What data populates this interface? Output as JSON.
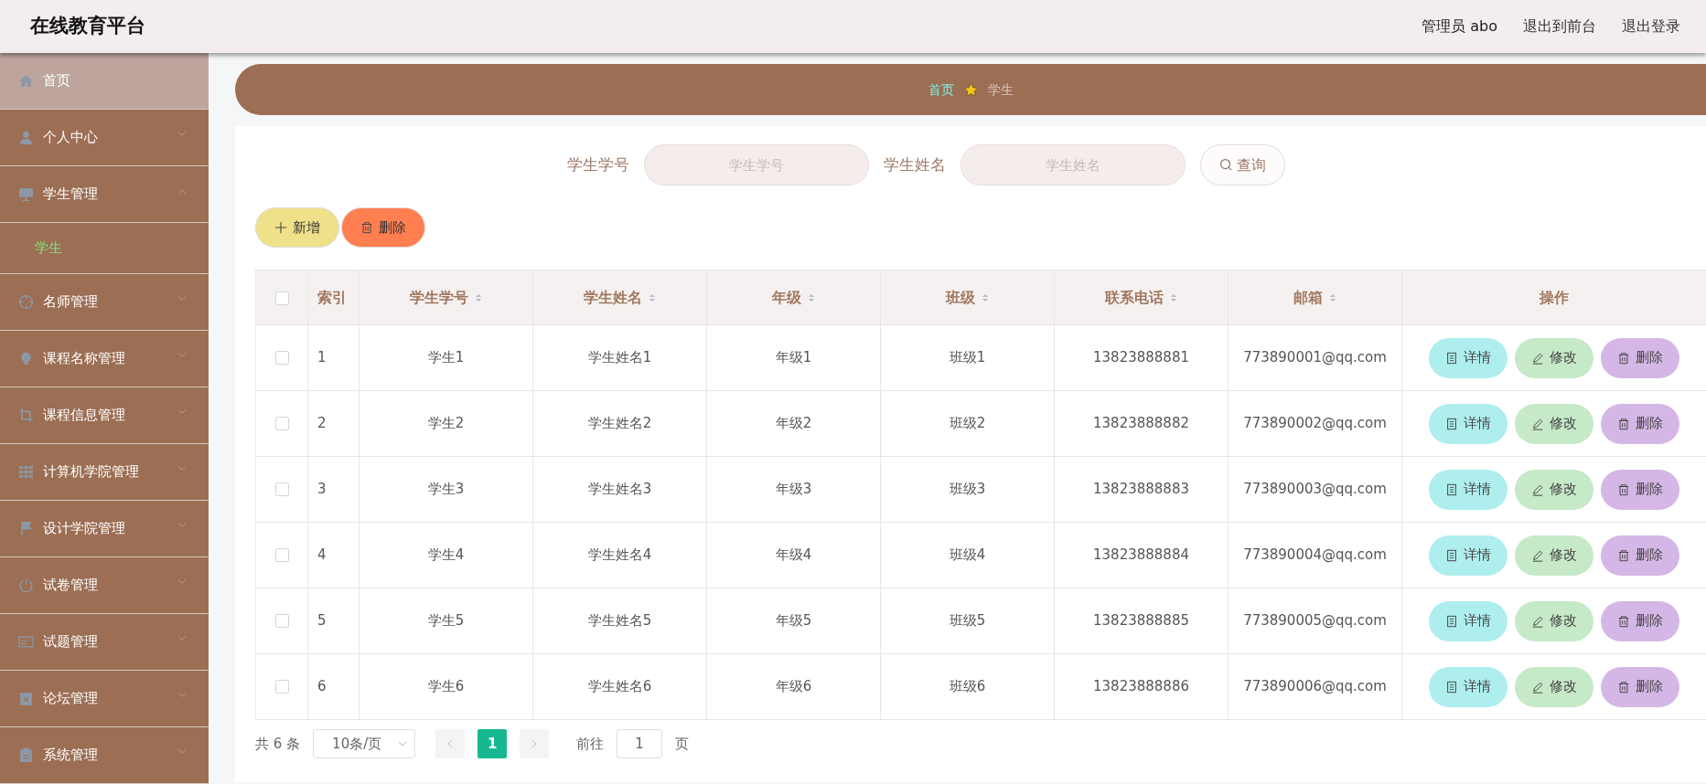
{
  "header": {
    "title": "在线教育平台",
    "links": [
      {
        "label": "管理员 abo",
        "kind": "user"
      },
      {
        "label": "退出到前台",
        "kind": "link"
      },
      {
        "label": "退出登录",
        "kind": "link"
      }
    ]
  },
  "sidebar": {
    "items": [
      {
        "label": "首页",
        "selected": true
      },
      {
        "label": "个人中心",
        "selected": false,
        "expanded": false
      },
      {
        "label": "学生管理",
        "selected": false,
        "expanded": true,
        "children": [
          {
            "label": "学生",
            "selected": true
          }
        ]
      },
      {
        "label": "名师管理",
        "selected": false,
        "expanded": false
      },
      {
        "label": "课程名称管理",
        "selected": false,
        "expanded": false
      },
      {
        "label": "课程信息管理",
        "selected": false,
        "expanded": false
      },
      {
        "label": "计算机学院管理",
        "selected": false,
        "expanded": false
      },
      {
        "label": "设计学院管理",
        "selected": false,
        "expanded": false
      },
      {
        "label": "试卷管理",
        "selected": false,
        "expanded": false
      },
      {
        "label": "试题管理",
        "selected": false,
        "expanded": false
      },
      {
        "label": "论坛管理",
        "selected": false,
        "expanded": false
      },
      {
        "label": "系统管理",
        "selected": false,
        "expanded": false
      }
    ]
  },
  "breadcrumb": [
    {
      "label": "首页",
      "kind": "link"
    },
    {
      "label": "学生",
      "kind": "current"
    }
  ],
  "search": {
    "fields": [
      {
        "label": "学生学号",
        "placeholder": "学生学号"
      },
      {
        "label": "学生姓名",
        "placeholder": "学生姓名"
      }
    ],
    "button": "查询"
  },
  "actions": [
    {
      "label": "新增",
      "kind": "add"
    },
    {
      "label": "删除",
      "kind": "delete"
    }
  ],
  "table": {
    "select_all": false,
    "columns": [
      {
        "label": "索引",
        "sortable": false
      },
      {
        "label": "学生学号",
        "sortable": true
      },
      {
        "label": "学生姓名",
        "sortable": true
      },
      {
        "label": "年级",
        "sortable": true
      },
      {
        "label": "班级",
        "sortable": true
      },
      {
        "label": "联系电话",
        "sortable": true
      },
      {
        "label": "邮箱",
        "sortable": true
      },
      {
        "label": "操作",
        "sortable": false
      }
    ],
    "rows": [
      {
        "checked": false,
        "cells": [
          "1",
          "学生1",
          "学生姓名1",
          "年级1",
          "班级1",
          "13823888881",
          "773890001@qq.com"
        ],
        "actions": [
          {
            "label": "详情",
            "kind": "detail"
          },
          {
            "label": "修改",
            "kind": "edit"
          },
          {
            "label": "删除",
            "kind": "delete"
          }
        ]
      },
      {
        "checked": false,
        "cells": [
          "2",
          "学生2",
          "学生姓名2",
          "年级2",
          "班级2",
          "13823888882",
          "773890002@qq.com"
        ],
        "actions": [
          {
            "label": "详情",
            "kind": "detail"
          },
          {
            "label": "修改",
            "kind": "edit"
          },
          {
            "label": "删除",
            "kind": "delete"
          }
        ]
      },
      {
        "checked": false,
        "cells": [
          "3",
          "学生3",
          "学生姓名3",
          "年级3",
          "班级3",
          "13823888883",
          "773890003@qq.com"
        ],
        "actions": [
          {
            "label": "详情",
            "kind": "detail"
          },
          {
            "label": "修改",
            "kind": "edit"
          },
          {
            "label": "删除",
            "kind": "delete"
          }
        ]
      },
      {
        "checked": false,
        "cells": [
          "4",
          "学生4",
          "学生姓名4",
          "年级4",
          "班级4",
          "13823888884",
          "773890004@qq.com"
        ],
        "actions": [
          {
            "label": "详情",
            "kind": "detail"
          },
          {
            "label": "修改",
            "kind": "edit"
          },
          {
            "label": "删除",
            "kind": "delete"
          }
        ]
      },
      {
        "checked": false,
        "cells": [
          "5",
          "学生5",
          "学生姓名5",
          "年级5",
          "班级5",
          "13823888885",
          "773890005@qq.com"
        ],
        "actions": [
          {
            "label": "详情",
            "kind": "detail"
          },
          {
            "label": "修改",
            "kind": "edit"
          },
          {
            "label": "删除",
            "kind": "delete"
          }
        ]
      },
      {
        "checked": false,
        "cells": [
          "6",
          "学生6",
          "学生姓名6",
          "年级6",
          "班级6",
          "13823888886",
          "773890006@qq.com"
        ],
        "actions": [
          {
            "label": "详情",
            "kind": "detail"
          },
          {
            "label": "修改",
            "kind": "edit"
          },
          {
            "label": "删除",
            "kind": "delete"
          }
        ]
      }
    ]
  },
  "pagination": {
    "total": "共 6 条",
    "page_size": "10条/页",
    "pages": [
      {
        "label": "1",
        "selected": true
      }
    ],
    "goto_label": "前往",
    "goto_value": "1",
    "goto_suffix": "页"
  }
}
